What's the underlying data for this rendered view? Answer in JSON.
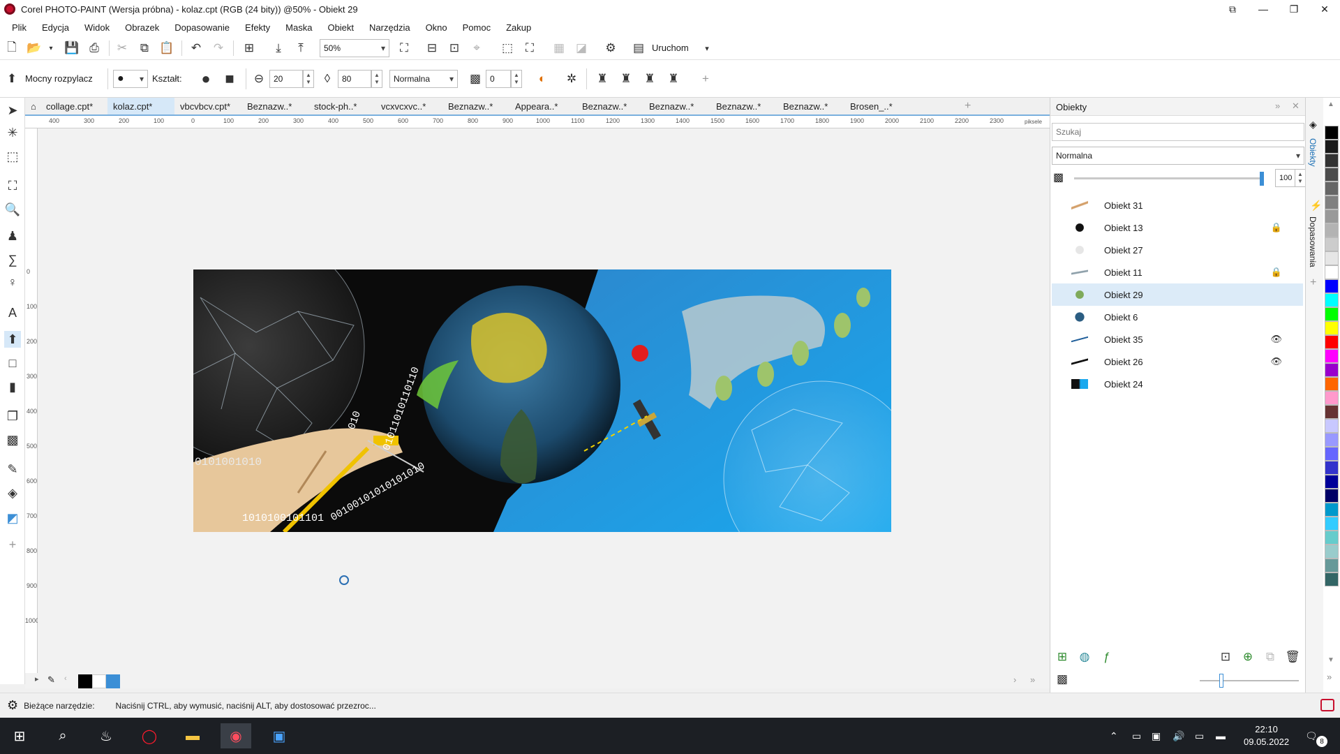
{
  "window": {
    "title": "Corel PHOTO-PAINT (Wersja próbna) - kolaz.cpt (RGB (24 bity)) @50% - Obiekt 29",
    "minimize": "—",
    "maximize": "❐",
    "close": "✕"
  },
  "menu": [
    "Plik",
    "Edycja",
    "Widok",
    "Obrazek",
    "Dopasowanie",
    "Efekty",
    "Maska",
    "Obiekt",
    "Narzędzia",
    "Okno",
    "Pomoc",
    "Zakup"
  ],
  "toolbar1": {
    "zoom_value": "50%",
    "launch_label": "Uruchom"
  },
  "toolbar2": {
    "tool_name": "Mocny rozpylacz",
    "shape_label": "Kształt:",
    "size_value": "20",
    "transparency_value": "80",
    "blend_mode": "Normalna",
    "opacity_value": "0"
  },
  "tabs": [
    "collage.cpt*",
    "kolaz.cpt*",
    "vbcvbcv.cpt*",
    "Beznazw..*",
    "stock-ph..*",
    "vcxvcxvc..*",
    "Beznazw..*",
    "Appeara..*",
    "Beznazw..*",
    "Beznazw..*",
    "Beznazw..*",
    "Beznazw..*",
    "Brosen_..*"
  ],
  "ruler": {
    "h_ticks": [
      "400",
      "300",
      "200",
      "100",
      "0",
      "100",
      "200",
      "300",
      "400",
      "500",
      "600",
      "700",
      "800",
      "900",
      "1000",
      "1100",
      "1200",
      "1300",
      "1400",
      "1500",
      "1600",
      "1700",
      "1800",
      "1900",
      "2000",
      "2100",
      "2200",
      "2300"
    ],
    "unit": "piksele",
    "v_ticks": [
      "0",
      "100",
      "200",
      "300",
      "400",
      "500",
      "600",
      "700",
      "800",
      "900",
      "1000"
    ]
  },
  "artwork": {
    "binary_1": "0101001010",
    "binary_2": "1010100101101",
    "binary_3": "00100101010101010",
    "binary_4": "01011010110110",
    "binary_5": "010"
  },
  "objects_panel": {
    "title": "Obiekty",
    "search_placeholder": "Szukaj",
    "blend_mode": "Normalna",
    "opacity": "100",
    "objects": [
      {
        "name": "Obiekt 31",
        "status": ""
      },
      {
        "name": "Obiekt 13",
        "status": "lock"
      },
      {
        "name": "Obiekt 27",
        "status": ""
      },
      {
        "name": "Obiekt 11",
        "status": "lock"
      },
      {
        "name": "Obiekt 29",
        "status": "",
        "selected": true
      },
      {
        "name": "Obiekt 6",
        "status": ""
      },
      {
        "name": "Obiekt 35",
        "status": "hidden"
      },
      {
        "name": "Obiekt 26",
        "status": "hidden"
      },
      {
        "name": "Obiekt 24",
        "status": ""
      }
    ],
    "lock_glyph": "🔒",
    "hidden_glyph": "👁"
  },
  "side_tabs": [
    "Obiekty",
    "Dopasowania"
  ],
  "status": {
    "label": "Bieżące narzędzie:",
    "message": "Naciśnij CTRL, aby wymusić, naciśnij ALT, aby dostosować przezroc..."
  },
  "taskbar": {
    "time": "22:10",
    "date": "09.05.2022",
    "notifications": "8"
  },
  "colors": {
    "accent": "#3c8fd6",
    "selected_row": "#dcebf8",
    "active_tab": "#d6e8f8",
    "taskbar": "#1c1f24"
  }
}
